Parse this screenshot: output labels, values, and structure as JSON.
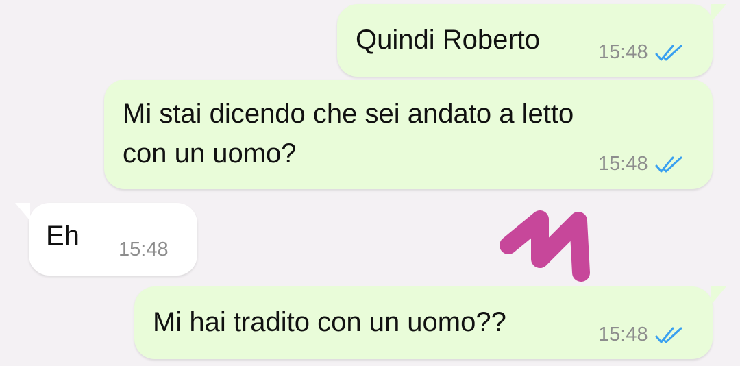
{
  "chat": {
    "messages": [
      {
        "direction": "outgoing",
        "text": "Quindi Roberto",
        "time": "15:48",
        "status": "read-double-check"
      },
      {
        "direction": "outgoing",
        "text": "Mi stai dicendo che sei andato a letto\ncon un uomo?",
        "line1": "Mi stai dicendo che sei andato a letto",
        "line2": "con un uomo?",
        "time": "15:48",
        "status": "read-double-check"
      },
      {
        "direction": "incoming",
        "text": "Eh",
        "time": "15:48"
      },
      {
        "direction": "outgoing",
        "text": "Mi hai tradito con un uomo??",
        "time": "15:48",
        "status": "read-double-check"
      }
    ]
  },
  "colors": {
    "background": "#f4f1f4",
    "outgoing_bubble": "#e9fcd9",
    "incoming_bubble": "#ffffff",
    "read_ticks": "#3aa0f0",
    "timestamp": "#8d8d8d",
    "scribble": "#c7479a"
  },
  "icons": {
    "read_status": "double-check-icon",
    "overlay": "pink-scribble"
  }
}
